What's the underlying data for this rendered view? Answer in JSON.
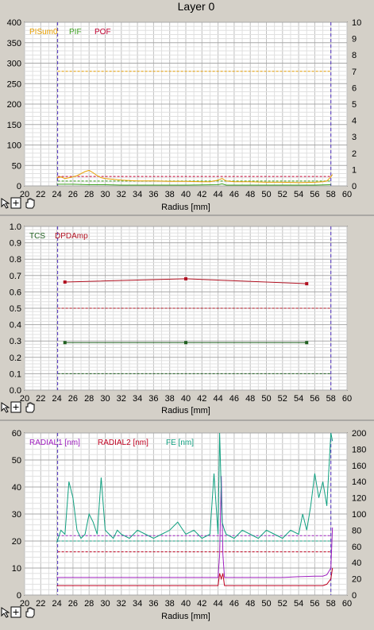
{
  "window": {
    "title": "Layer 0"
  },
  "chart_data": [
    {
      "type": "line",
      "xlabel": "Radius [mm]",
      "xlim": [
        20,
        60
      ],
      "x_ticks": [
        "20",
        "22",
        "24",
        "26",
        "28",
        "30",
        "32",
        "34",
        "36",
        "38",
        "40",
        "42",
        "44",
        "46",
        "48",
        "50",
        "52",
        "54",
        "56",
        "58",
        "60"
      ],
      "y_left": {
        "lim": [
          0,
          400
        ],
        "ticks": [
          "0",
          "50",
          "100",
          "150",
          "200",
          "250",
          "300",
          "350",
          "400"
        ]
      },
      "y_right": {
        "lim": [
          0,
          10
        ],
        "ticks": [
          "0",
          "1",
          "2",
          "3",
          "4",
          "5",
          "6",
          "7",
          "8",
          "9",
          "10"
        ]
      },
      "grid": true,
      "legend_position": "top-left",
      "vertical_markers": [
        24.1,
        58
      ],
      "series": [
        {
          "name": "PISum0",
          "color": "#e8a000",
          "axis": "left",
          "x": [
            24,
            24.5,
            25,
            25.5,
            26,
            26.5,
            27,
            27.5,
            28,
            28.5,
            29,
            29.5,
            30,
            31,
            32,
            34,
            36,
            38,
            40,
            42,
            43,
            44,
            44.5,
            45,
            46,
            48,
            50,
            52,
            54,
            56,
            57,
            57.5,
            58,
            58.2
          ],
          "values": [
            20,
            22,
            18,
            20,
            22,
            25,
            30,
            35,
            38,
            32,
            25,
            20,
            18,
            16,
            14,
            12,
            12,
            11,
            11,
            10,
            10,
            14,
            18,
            12,
            10,
            10,
            9,
            9,
            8,
            9,
            10,
            12,
            22,
            28
          ]
        },
        {
          "name": "PIF",
          "color": "#3ca020",
          "axis": "left",
          "x": [
            24,
            26,
            28,
            30,
            32,
            36,
            40,
            44,
            44.5,
            45,
            48,
            52,
            56,
            58
          ],
          "values": [
            4,
            4,
            3,
            3,
            2,
            2,
            2,
            3,
            5,
            2,
            2,
            2,
            2,
            3
          ]
        },
        {
          "name": "POF",
          "color": "#c00030",
          "axis": "left",
          "x": [],
          "values": []
        }
      ],
      "threshold_lines": [
        {
          "value": 280,
          "color": "#e8a000"
        },
        {
          "value": 23,
          "color": "#c00030"
        },
        {
          "value": 12,
          "color": "#3ca020"
        }
      ]
    },
    {
      "type": "line",
      "xlabel": "Radius [mm]",
      "xlim": [
        20,
        60
      ],
      "x_ticks": [
        "20",
        "22",
        "24",
        "26",
        "28",
        "30",
        "32",
        "34",
        "36",
        "38",
        "40",
        "42",
        "44",
        "46",
        "48",
        "50",
        "52",
        "54",
        "56",
        "58",
        "60"
      ],
      "y_left": {
        "lim": [
          0,
          1
        ],
        "ticks": [
          "0.0",
          "0.1",
          "0.2",
          "0.3",
          "0.4",
          "0.5",
          "0.6",
          "0.7",
          "0.8",
          "0.9",
          "1.0"
        ]
      },
      "grid": true,
      "legend_position": "top-left",
      "vertical_markers": [
        24.1,
        58
      ],
      "series": [
        {
          "name": "TCS",
          "color": "#206020",
          "x": [
            25,
            40,
            55
          ],
          "values": [
            0.29,
            0.29,
            0.29
          ]
        },
        {
          "name": "DPDAmp",
          "color": "#b01020",
          "x": [
            25,
            40,
            55
          ],
          "values": [
            0.66,
            0.68,
            0.65
          ]
        }
      ],
      "threshold_lines": [
        {
          "value": 0.5,
          "color": "#b01020"
        },
        {
          "value": 0.1,
          "color": "#206020"
        }
      ]
    },
    {
      "type": "line",
      "xlabel": "Radius [mm]",
      "xlim": [
        20,
        60
      ],
      "x_ticks": [
        "20",
        "22",
        "24",
        "26",
        "28",
        "30",
        "32",
        "34",
        "36",
        "38",
        "40",
        "42",
        "44",
        "46",
        "48",
        "50",
        "52",
        "54",
        "56",
        "58",
        "60"
      ],
      "y_left": {
        "lim": [
          0,
          60
        ],
        "ticks": [
          "0",
          "10",
          "20",
          "30",
          "40",
          "50",
          "60"
        ]
      },
      "y_right": {
        "lim": [
          0,
          200
        ],
        "ticks": [
          "0",
          "20",
          "40",
          "60",
          "80",
          "100",
          "120",
          "140",
          "160",
          "180",
          "200"
        ]
      },
      "grid": true,
      "legend_position": "top-left",
      "vertical_markers": [
        24.1,
        58
      ],
      "series": [
        {
          "name": "RADIAL1 [nm]",
          "color": "#a020c0",
          "axis": "left",
          "x": [
            24,
            26,
            28,
            30,
            32,
            34,
            36,
            38,
            40,
            42,
            43,
            44,
            44.2,
            44.4,
            44.6,
            44.8,
            45,
            46,
            48,
            50,
            52,
            54,
            56,
            57,
            57.5,
            58,
            58.2
          ],
          "values": [
            6.5,
            6.5,
            6.5,
            6.5,
            6.5,
            6.5,
            6.5,
            6.5,
            6.5,
            6.5,
            6.5,
            6.5,
            15,
            44,
            15,
            6.5,
            6.5,
            6.5,
            6.5,
            6.5,
            6.5,
            6.8,
            7,
            7,
            7.5,
            10,
            25
          ]
        },
        {
          "name": "RADIAL2 [nm]",
          "color": "#c00020",
          "axis": "left",
          "x": [
            24,
            26,
            28,
            30,
            32,
            34,
            36,
            38,
            40,
            42,
            43,
            44,
            44.2,
            44.4,
            44.6,
            44.8,
            45,
            46,
            48,
            50,
            52,
            54,
            56,
            57,
            57.5,
            58,
            58.2
          ],
          "values": [
            3.5,
            3.5,
            3.5,
            3.5,
            3.5,
            3.5,
            3.5,
            3.5,
            3.5,
            3.5,
            3.5,
            3.5,
            8,
            6,
            8,
            3.5,
            3.5,
            3.5,
            3.5,
            3.5,
            3.5,
            3.5,
            3.5,
            3.5,
            4,
            6,
            10
          ]
        },
        {
          "name": "FE [nm]",
          "color": "#10a080",
          "axis": "right",
          "x": [
            24,
            24.5,
            25,
            25.5,
            26,
            26.5,
            27,
            27.5,
            28,
            28.5,
            29,
            29.5,
            30,
            30.5,
            31,
            31.5,
            32,
            33,
            34,
            35,
            36,
            37,
            38,
            39,
            40,
            41,
            42,
            43,
            43.5,
            44,
            44.2,
            44.5,
            44.8,
            45,
            46,
            47,
            48,
            49,
            50,
            51,
            52,
            53,
            54,
            54.5,
            55,
            55.5,
            56,
            56.5,
            57,
            57.5,
            58,
            58.2
          ],
          "values": [
            65,
            80,
            75,
            140,
            120,
            80,
            70,
            75,
            100,
            90,
            75,
            145,
            80,
            75,
            70,
            80,
            75,
            70,
            80,
            75,
            70,
            75,
            80,
            90,
            75,
            80,
            70,
            75,
            150,
            75,
            200,
            90,
            80,
            75,
            70,
            80,
            75,
            70,
            80,
            75,
            70,
            80,
            75,
            100,
            80,
            110,
            150,
            120,
            140,
            110,
            200,
            190
          ]
        }
      ],
      "threshold_lines": [
        {
          "value": 22,
          "color": "#a020c0"
        },
        {
          "value": 16,
          "color": "#c00020"
        },
        {
          "value": 20,
          "color": "#10a080"
        }
      ]
    }
  ],
  "toolbar": {
    "icons": [
      "pointer-icon",
      "zoom-icon",
      "hand-icon"
    ]
  }
}
